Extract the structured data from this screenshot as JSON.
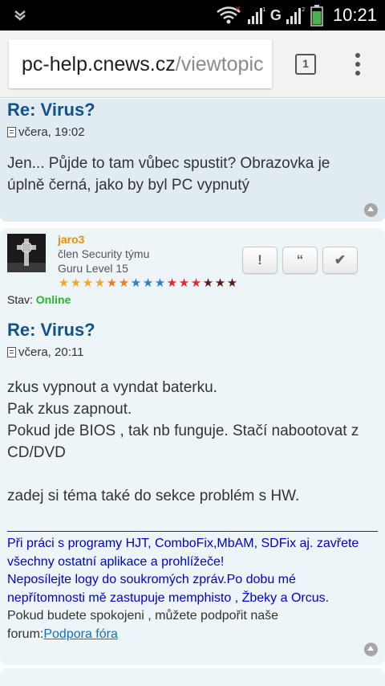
{
  "status_bar": {
    "time": "10:21",
    "network_label": "G",
    "icons": [
      "download-notification-icon",
      "wifi-icon",
      "signal-icon",
      "signal-icon",
      "battery-icon"
    ]
  },
  "browser": {
    "url_host": "pc-help.cnews.cz",
    "url_path": "/viewtopic",
    "tab_count": "1"
  },
  "posts": [
    {
      "title": "Re: Virus?",
      "date": "včera, 19:02",
      "body": [
        "Jen... Půjde to tam vůbec spustit? Obrazovka je",
        "úplně černá, jako by byl PC vypnutý"
      ]
    },
    {
      "author": "jaro3",
      "rank_line1": "člen Security týmu",
      "rank_line2": "Guru Level 15",
      "status_label": "Stav: ",
      "status_value": "Online",
      "buttons": {
        "report": "!",
        "quote": "“",
        "thanks": "✔"
      },
      "title": "Re: Virus?",
      "date": "včera, 20:11",
      "body": [
        "zkus vypnout a vyndat baterku.",
        "Pak zkus zapnout.",
        "Pokud jde BIOS , tak nb funguje. Stačí nabootovat z",
        "CD/DVD",
        "",
        "zadej si téma také do sekce problém s HW."
      ],
      "signature": {
        "line1": "Při práci s programy HJT, ComboFix,MbAM, SDFix aj. zavřete",
        "line2": "všechny ostatní aplikace a prohlížeče!",
        "line3": "Neposílejte logy do soukromých zpráv.Po dobu mé",
        "line4": "nepřítomnosti mě zastupuje memphisto , Žbeky a Orcus.",
        "line5": "Pokud budete spokojeni , můžete podpořit naše",
        "line6_prefix": "forum:",
        "link": "Podpora fóra"
      },
      "stars": [
        "#f5a623",
        "#f5a623",
        "#f5a623",
        "#f5a623",
        "#f07c1e",
        "#f07c1e",
        "#2a7fd6",
        "#2a7fd6",
        "#2a7fd6",
        "#e8262e",
        "#e8262e",
        "#e8262e",
        "#5a1a1a",
        "#5a1a1a",
        "#5a1a1a"
      ]
    }
  ],
  "colors": {
    "title": "#105289",
    "author": "#ec8e02",
    "online": "#23b72f",
    "post_bg_1": "#e1ebf2",
    "post_bg_2": "#eef5f9"
  }
}
